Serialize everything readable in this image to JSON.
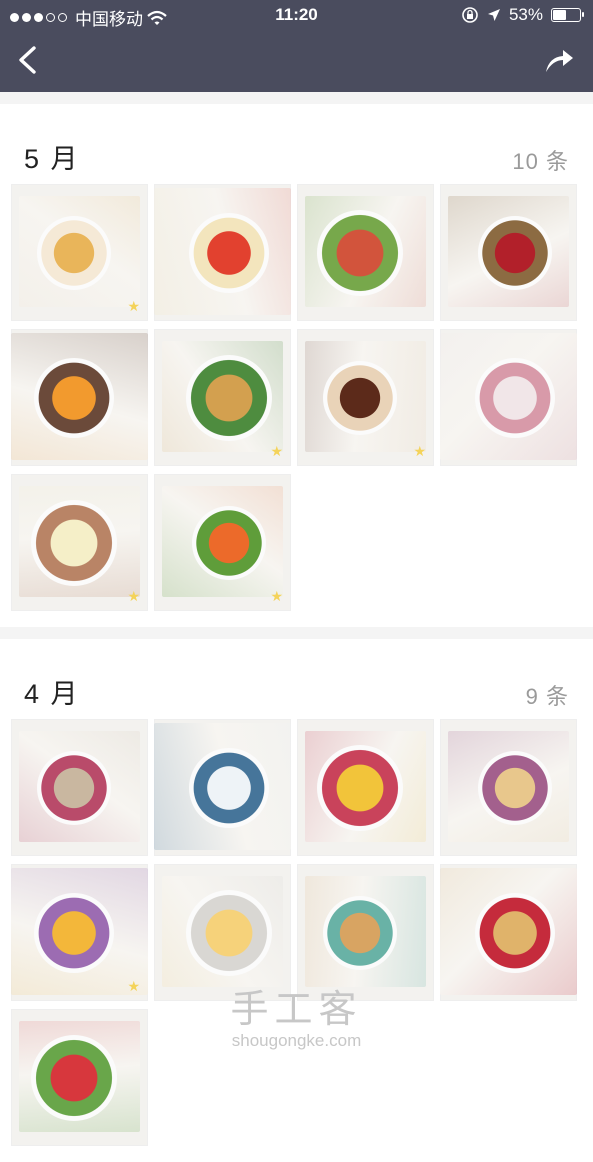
{
  "status_bar": {
    "carrier": "中国移动",
    "time": "11:20",
    "battery": "53%",
    "battery_level": 0.53,
    "signal_bars_full": 3,
    "signal_bars_total": 5,
    "icons": [
      "wifi-icon",
      "orientation-lock-icon",
      "location-icon",
      "battery-icon"
    ]
  },
  "nav": {
    "back_icon": "chevron-left-icon",
    "share_icon": "share-arrow-icon",
    "bar_color": "#4a4c5e"
  },
  "sections": [
    {
      "title": "5 月",
      "count": "10 条",
      "photos": [
        {
          "name": "breakfast-plate-croissant",
          "colors": [
            "#e9b55a",
            "#f5e9d6"
          ],
          "starred": true
        },
        {
          "name": "crepe-with-tomatoes",
          "colors": [
            "#e2412f",
            "#f3e5bd"
          ],
          "starred": false
        },
        {
          "name": "bowl-with-greens-and-ham",
          "colors": [
            "#d2543c",
            "#77a84b"
          ],
          "starred": false
        },
        {
          "name": "kfc-cup-and-pastry",
          "colors": [
            "#b2202a",
            "#8c6b42"
          ],
          "starred": false
        },
        {
          "name": "fruit-and-noodle-bowls",
          "colors": [
            "#f29a2e",
            "#6b4a3a"
          ],
          "starred": false
        },
        {
          "name": "scallion-pancake-in-bag",
          "colors": [
            "#d3a04f",
            "#4e8c3f"
          ],
          "starred": true
        },
        {
          "name": "noodle-soup-bowl",
          "colors": [
            "#5c2a1a",
            "#e9d3b8"
          ],
          "starred": true
        },
        {
          "name": "wrapped-sandwich",
          "colors": [
            "#f1e6e8",
            "#d89aa9"
          ],
          "starred": false
        },
        {
          "name": "bowl-of-melon-cubes",
          "colors": [
            "#f5efc8",
            "#b98466"
          ],
          "starred": true
        },
        {
          "name": "kimchi-and-kiwi-bowl",
          "colors": [
            "#ec6a2a",
            "#5f9d3a"
          ],
          "starred": true
        }
      ]
    },
    {
      "title": "4 月",
      "count": "9 条",
      "photos": [
        {
          "name": "dumplings-and-milk",
          "colors": [
            "#c9b7a0",
            "#b94b6a"
          ],
          "starred": false
        },
        {
          "name": "mug-on-desk",
          "colors": [
            "#eef3f7",
            "#46759a"
          ],
          "starred": false
        },
        {
          "name": "scrambled-eggs-tomato",
          "colors": [
            "#f2c43a",
            "#c9435b"
          ],
          "starred": false
        },
        {
          "name": "pancake-and-soup",
          "colors": [
            "#e8c78c",
            "#a3608d"
          ],
          "starred": false
        },
        {
          "name": "mango-and-milk",
          "colors": [
            "#f3b73a",
            "#9c6cb2"
          ],
          "starred": true
        },
        {
          "name": "fried-egg-and-bread",
          "colors": [
            "#f6d27a",
            "#d9d7d3"
          ],
          "starred": false
        },
        {
          "name": "toast-and-vegetables",
          "colors": [
            "#d8a462",
            "#69b2a6"
          ],
          "starred": false
        },
        {
          "name": "toast-salad-and-jam",
          "colors": [
            "#e0b36a",
            "#c52b3c"
          ],
          "starred": false
        },
        {
          "name": "strawberry-salad-plate",
          "colors": [
            "#d7373d",
            "#69a64a"
          ],
          "starred": false
        }
      ]
    }
  ],
  "watermark": {
    "title": "手工客",
    "url": "shougongke.com"
  }
}
